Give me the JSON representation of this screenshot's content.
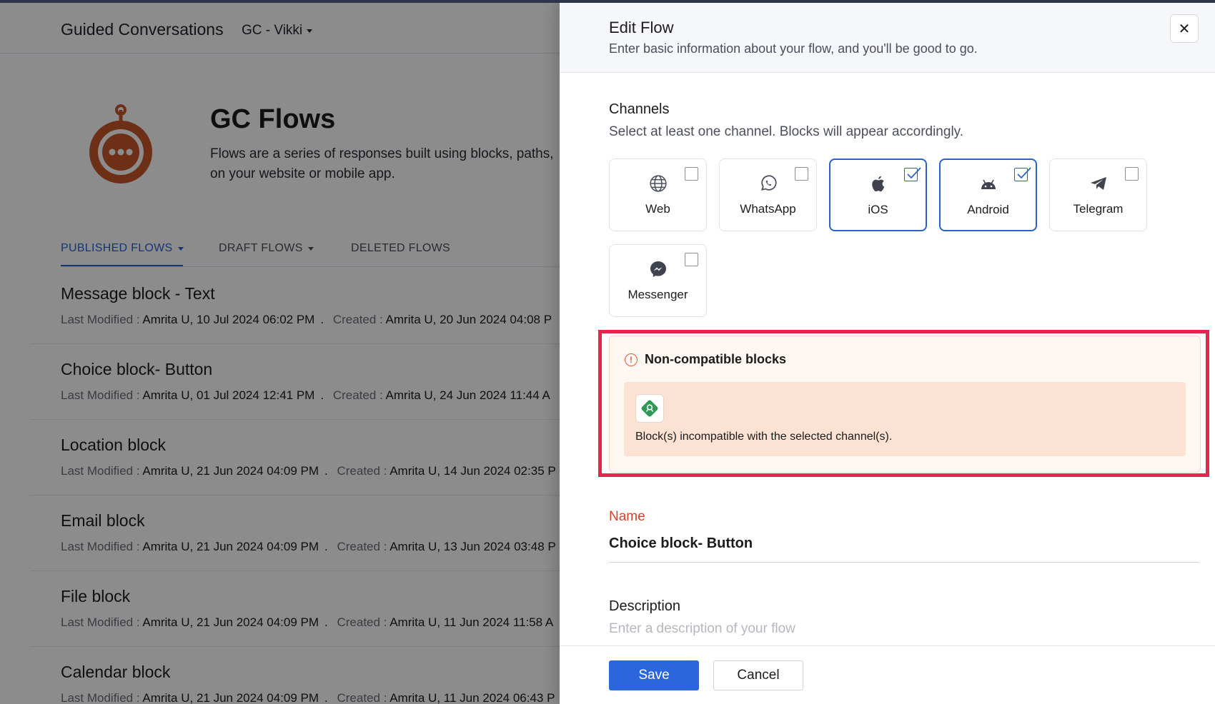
{
  "app": {
    "title": "Guided Conversations",
    "bot_selector": "GC - Vikki"
  },
  "page": {
    "title": "GC Flows",
    "description": "Flows are a series of responses built using blocks, paths, ... on your website or mobile app.",
    "description_line1": "Flows are a series of responses built using blocks, paths,",
    "description_line2": "on your website or mobile app."
  },
  "tabs": [
    {
      "label": "PUBLISHED FLOWS",
      "active": true,
      "has_dropdown": true
    },
    {
      "label": "DRAFT FLOWS",
      "active": false,
      "has_dropdown": true
    },
    {
      "label": "DELETED FLOWS",
      "active": false,
      "has_dropdown": false
    }
  ],
  "flows": [
    {
      "name": "Message block - Text",
      "modified_label": "Last Modified :",
      "modified_by": "Amrita U",
      "modified_at": "10 Jul 2024 06:02 PM",
      "created_label": "Created :",
      "created_by": "Amrita U",
      "created_at": "20 Jun 2024 04:08 P"
    },
    {
      "name": "Choice block- Button",
      "modified_label": "Last Modified :",
      "modified_by": "Amrita U",
      "modified_at": "01 Jul 2024 12:41 PM",
      "created_label": "Created :",
      "created_by": "Amrita U",
      "created_at": "24 Jun 2024 11:44 A"
    },
    {
      "name": "Location block",
      "modified_label": "Last Modified :",
      "modified_by": "Amrita U",
      "modified_at": "21 Jun 2024 04:09 PM",
      "created_label": "Created :",
      "created_by": "Amrita U",
      "created_at": "14 Jun 2024 02:35 P"
    },
    {
      "name": "Email block",
      "modified_label": "Last Modified :",
      "modified_by": "Amrita U",
      "modified_at": "21 Jun 2024 04:09 PM",
      "created_label": "Created :",
      "created_by": "Amrita U",
      "created_at": "13 Jun 2024 03:48 P"
    },
    {
      "name": "File block",
      "modified_label": "Last Modified :",
      "modified_by": "Amrita U",
      "modified_at": "21 Jun 2024 04:09 PM",
      "created_label": "Created :",
      "created_by": "Amrita U",
      "created_at": "11 Jun 2024 11:58 A"
    },
    {
      "name": "Calendar block",
      "modified_label": "Last Modified :",
      "modified_by": "Amrita U",
      "modified_at": "21 Jun 2024 04:09 PM",
      "created_label": "Created :",
      "created_by": "Amrita U",
      "created_at": "11 Jun 2024 06:43 P"
    }
  ],
  "panel": {
    "title": "Edit Flow",
    "subtitle": "Enter basic information about your flow, and you'll be good to go.",
    "close_icon": "close-icon",
    "channels_label": "Channels",
    "channels_hint": "Select at least one channel. Blocks will appear accordingly.",
    "channels": [
      {
        "label": "Web",
        "icon": "globe-icon",
        "checked": false
      },
      {
        "label": "WhatsApp",
        "icon": "whatsapp-icon",
        "checked": false
      },
      {
        "label": "iOS",
        "icon": "apple-icon",
        "checked": true
      },
      {
        "label": "Android",
        "icon": "android-icon",
        "checked": true
      },
      {
        "label": "Telegram",
        "icon": "telegram-icon",
        "checked": false
      },
      {
        "label": "Messenger",
        "icon": "messenger-icon",
        "checked": false
      }
    ],
    "warning": {
      "title": "Non-compatible blocks",
      "message": "Block(s) incompatible with the selected channel(s).",
      "block_icon": "location-block-icon"
    },
    "name_label": "Name",
    "name_value": "Choice block- Button",
    "description_label": "Description",
    "description_placeholder": "Enter a description of your flow",
    "save_label": "Save",
    "cancel_label": "Cancel"
  },
  "colors": {
    "accent": "#2B66DF",
    "highlight": "#E6254F",
    "warning": "#E0593A",
    "required": "#D9402B",
    "bot_logo": "#C8562A"
  }
}
